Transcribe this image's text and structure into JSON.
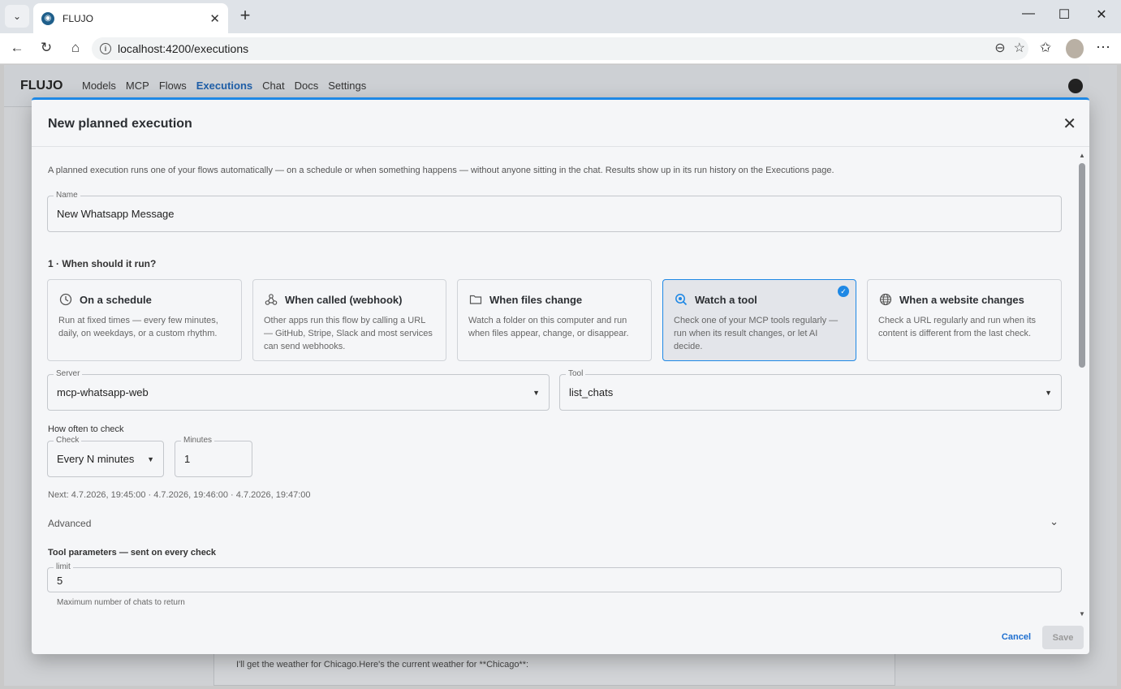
{
  "browser": {
    "tab_title": "FLUJO",
    "url": "localhost:4200/executions"
  },
  "app": {
    "brand": "FLUJO",
    "nav": [
      "Models",
      "MCP",
      "Flows",
      "Executions",
      "Chat",
      "Docs",
      "Settings"
    ],
    "active_nav": "Executions",
    "background_chat_text": "I'll get the weather for Chicago.Here's the current weather for **Chicago**:"
  },
  "modal": {
    "title": "New planned execution",
    "intro": "A planned execution runs one of your flows automatically — on a schedule or when something happens — without anyone sitting in the chat. Results show up in its run history on the Executions page.",
    "name_label": "Name",
    "name_value": "New Whatsapp Message",
    "section1": "1 · When should it run?",
    "triggers": [
      {
        "title": "On a schedule",
        "desc": "Run at fixed times — every few minutes, daily, on weekdays, or a custom rhythm.",
        "icon": "clock-icon"
      },
      {
        "title": "When called (webhook)",
        "desc": "Other apps run this flow by calling a URL — GitHub, Stripe, Slack and most services can send webhooks.",
        "icon": "webhook-icon"
      },
      {
        "title": "When files change",
        "desc": "Watch a folder on this computer and run when files appear, change, or disappear.",
        "icon": "folder-icon"
      },
      {
        "title": "Watch a tool",
        "desc": "Check one of your MCP tools regularly — run when its result changes, or let AI decide.",
        "icon": "watch-tool-icon",
        "selected": true
      },
      {
        "title": "When a website changes",
        "desc": "Check a URL regularly and run when its content is different from the last check.",
        "icon": "globe-icon"
      }
    ],
    "server_label": "Server",
    "server_value": "mcp-whatsapp-web",
    "tool_label": "Tool",
    "tool_value": "list_chats",
    "how_often": "How often to check",
    "check_label": "Check",
    "check_value": "Every N minutes",
    "minutes_label": "Minutes",
    "minutes_value": "1",
    "next": "Next: 4.7.2026, 19:45:00 · 4.7.2026, 19:46:00 · 4.7.2026, 19:47:00",
    "advanced": "Advanced",
    "tool_params": "Tool parameters — sent on every check",
    "limit_label": "limit",
    "limit_value": "5",
    "limit_hint": "Maximum number of chats to return",
    "cancel": "Cancel",
    "save": "Save"
  },
  "colors": {
    "accent": "#1e88e5",
    "selected_card_bg": "#e3e5ea"
  }
}
